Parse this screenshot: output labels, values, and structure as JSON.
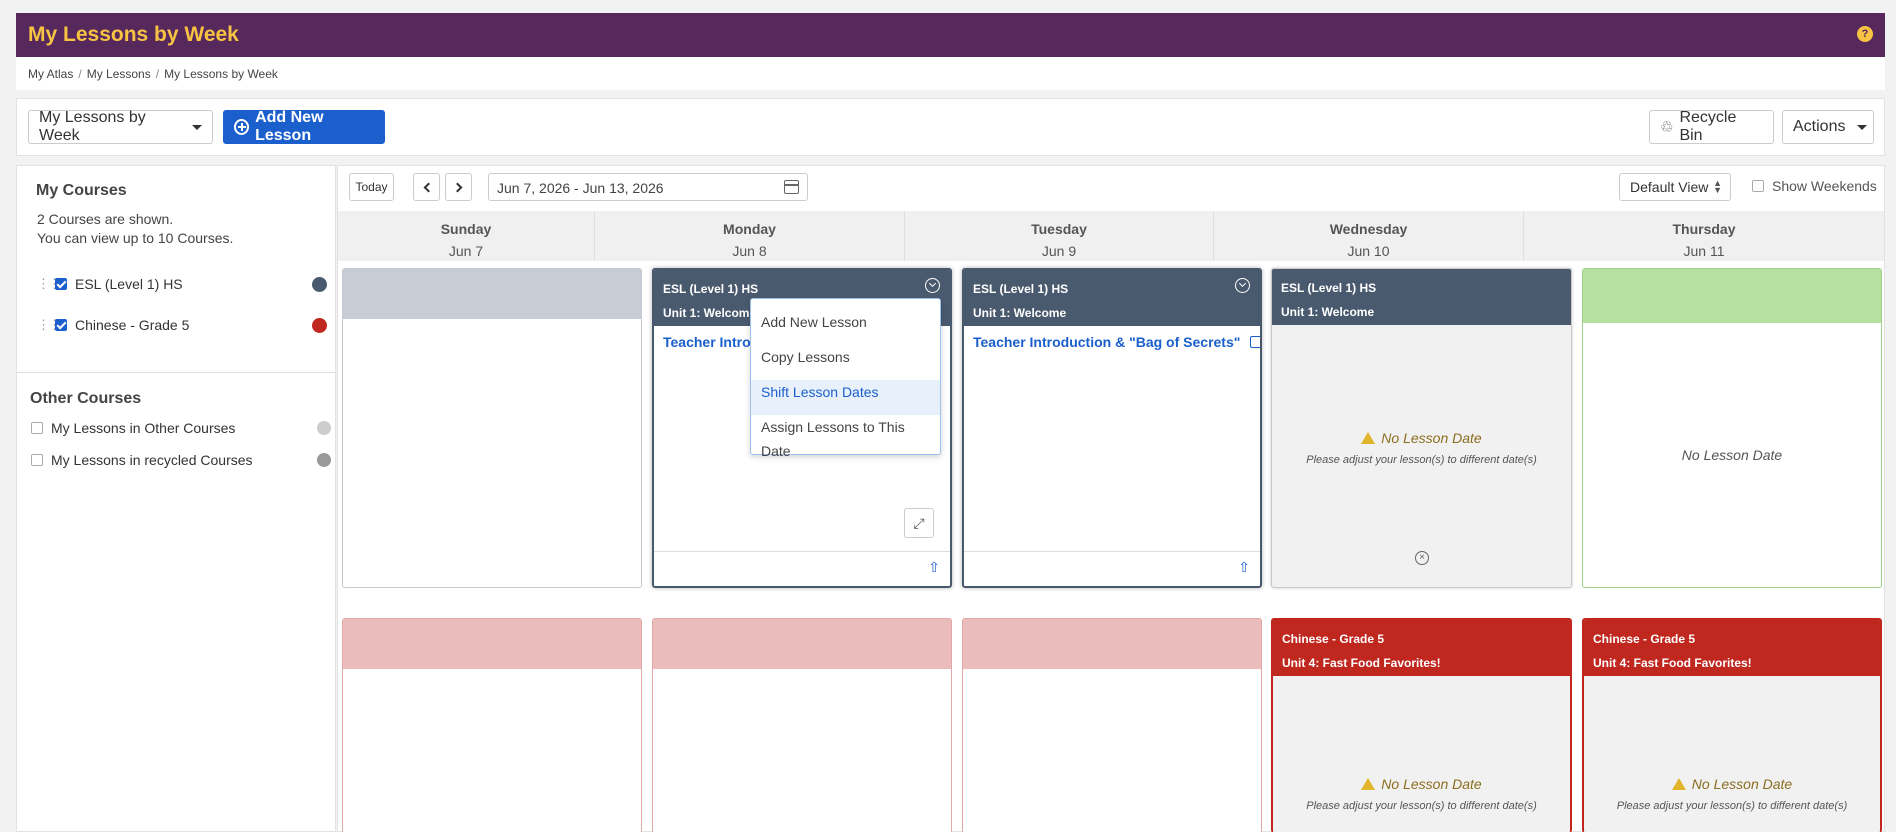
{
  "header": {
    "title": "My Lessons by Week",
    "help_glyph": "?"
  },
  "breadcrumb": [
    "My Atlas",
    "My Lessons",
    "My Lessons by Week"
  ],
  "toolbar": {
    "view_select": "My Lessons by Week",
    "add_lesson": "Add New Lesson",
    "recycle_bin": "Recycle Bin",
    "actions": "Actions"
  },
  "sidebar": {
    "my_courses_title": "My Courses",
    "shown_text": "2 Courses are shown.",
    "limit_text": "You can view up to 10 Courses.",
    "courses": [
      {
        "name": "ESL (Level 1) HS",
        "color": "#4a5a6e",
        "checked": true
      },
      {
        "name": "Chinese - Grade 5",
        "color": "#c0271f",
        "checked": true
      }
    ],
    "other_title": "Other Courses",
    "other_courses": [
      {
        "name": "My Lessons in Other Courses",
        "color": "#cccccc"
      },
      {
        "name": "My Lessons in recycled Courses",
        "color": "#999999"
      }
    ]
  },
  "calendar": {
    "today": "Today",
    "date_range": "Jun 7, 2026 - Jun 13, 2026",
    "view_mode": "Default View",
    "show_weekends": "Show Weekends",
    "days": [
      {
        "name": "Sunday",
        "date": "Jun 7"
      },
      {
        "name": "Monday",
        "date": "Jun 8"
      },
      {
        "name": "Tuesday",
        "date": "Jun 9"
      },
      {
        "name": "Wednesday",
        "date": "Jun 10"
      },
      {
        "name": "Thursday",
        "date": "Jun 11"
      }
    ],
    "esl_course": "ESL (Level 1) HS",
    "esl_unit": "Unit 1: Welcome",
    "lesson_title": "Teacher Introduction & \"Bag of Secrets\"",
    "lesson_title_truncated": "Teacher Introd",
    "chinese_course": "Chinese - Grade 5",
    "chinese_unit": "Unit 4: Fast Food Favorites!",
    "no_lesson_date": "No Lesson Date",
    "adjust_text": "Please adjust your lesson(s) to different date(s)"
  },
  "context_menu": [
    "Add New Lesson",
    "Copy Lessons",
    "Shift Lesson Dates",
    "Assign Lessons to This Date"
  ],
  "colors": {
    "brand": "#56285c",
    "accent": "#f6c343",
    "primary": "#1b5fcc",
    "esl": "#4a5a6e",
    "chinese": "#c0271f"
  }
}
